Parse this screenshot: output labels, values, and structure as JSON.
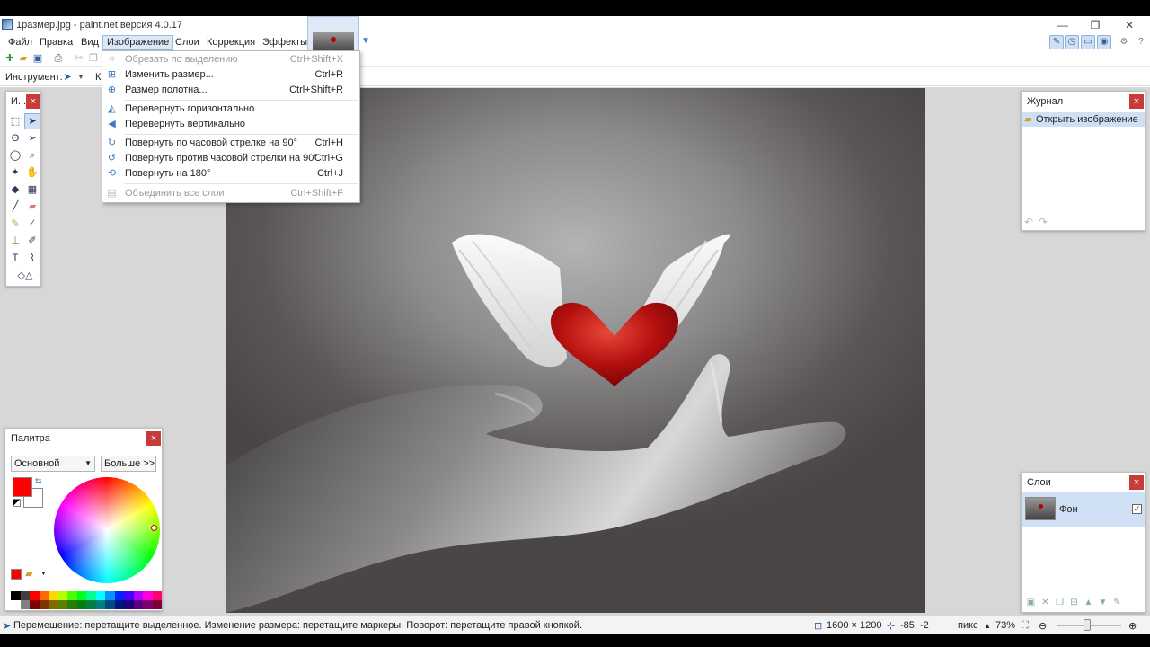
{
  "window": {
    "title": "1размер.jpg - paint.net версия 4.0.17",
    "minimize": "—",
    "maximize": "❐",
    "close": "✕"
  },
  "menu": [
    "Файл",
    "Правка",
    "Вид",
    "Изображение",
    "Слои",
    "Коррекция",
    "Эффекты"
  ],
  "toolbar": {
    "tool_label": "Инструмент:",
    "truncated_label": "К"
  },
  "image_menu": {
    "items": [
      {
        "label": "Обрезать по выделению",
        "shortcut": "Ctrl+Shift+X",
        "enabled": false,
        "icon": "crop-icon"
      },
      {
        "label": "Изменить размер...",
        "shortcut": "Ctrl+R",
        "enabled": true,
        "icon": "resize-icon"
      },
      {
        "label": "Размер полотна...",
        "shortcut": "Ctrl+Shift+R",
        "enabled": true,
        "icon": "canvas-size-icon"
      },
      {
        "label": "Перевернуть горизонтально",
        "shortcut": "",
        "enabled": true,
        "icon": "flip-horizontal-icon"
      },
      {
        "label": "Перевернуть вертикально",
        "shortcut": "",
        "enabled": true,
        "icon": "flip-vertical-icon"
      },
      {
        "label": "Повернуть по часовой стрелке на 90°",
        "shortcut": "Ctrl+H",
        "enabled": true,
        "icon": "rotate-cw-icon"
      },
      {
        "label": "Повернуть против часовой стрелки на 90°",
        "shortcut": "Ctrl+G",
        "enabled": true,
        "icon": "rotate-ccw-icon"
      },
      {
        "label": "Повернуть на 180°",
        "shortcut": "Ctrl+J",
        "enabled": true,
        "icon": "rotate-180-icon"
      },
      {
        "label": "Объединить все слои",
        "shortcut": "Ctrl+Shift+F",
        "enabled": false,
        "icon": "flatten-icon"
      }
    ]
  },
  "tools_panel": {
    "title": "И..."
  },
  "history_panel": {
    "title": "Журнал",
    "items": [
      "Открыть изображение"
    ]
  },
  "palette_panel": {
    "title": "Палитра",
    "mode": "Основной",
    "more_button": "Больше >>",
    "primary_color": "#ff0000",
    "secondary_color": "#ffffff"
  },
  "layers_panel": {
    "title": "Слои",
    "layers": [
      {
        "name": "Фон",
        "visible": true
      }
    ]
  },
  "status": {
    "hint": "Перемещение: перетащите выделенное. Изменение размера: перетащите маркеры. Поворот: перетащите правой кнопкой.",
    "image_size": "1600 × 1200",
    "cursor_pos": "-85, -2",
    "units": "пикс",
    "zoom": "73%"
  }
}
